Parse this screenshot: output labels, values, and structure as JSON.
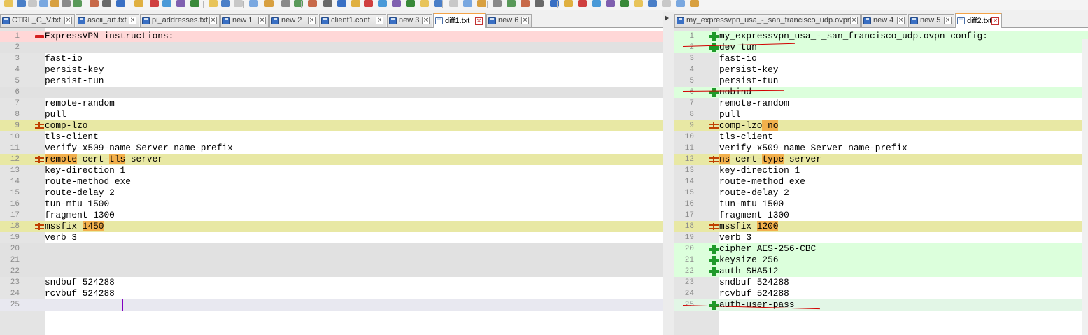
{
  "left_tabs": [
    {
      "label": "CTRL_C_V.txt",
      "active": false
    },
    {
      "label": "ascii_art.txt",
      "active": false
    },
    {
      "label": "pi_addresses.txt",
      "active": false
    },
    {
      "label": "new 1",
      "active": false
    },
    {
      "label": "new 2",
      "active": false
    },
    {
      "label": "client1.conf",
      "active": false
    },
    {
      "label": "new 3",
      "active": false
    },
    {
      "label": "diff1.txt",
      "active": true
    },
    {
      "label": "new 6",
      "active": false
    }
  ],
  "right_tabs": [
    {
      "label": "my_expressvpn_usa_-_san_francisco_udp.ovpn",
      "active": false
    },
    {
      "label": "new 4",
      "active": false
    },
    {
      "label": "new 5",
      "active": false
    },
    {
      "label": "diff2.txt",
      "active": true
    }
  ],
  "left_lines": [
    {
      "num": "1",
      "text": "ExpressVPN instructions:",
      "bg": "red",
      "marker": "minus"
    },
    {
      "num": "2",
      "text": "",
      "bg": "gray",
      "marker": ""
    },
    {
      "num": "3",
      "text": "fast-io",
      "bg": "",
      "marker": ""
    },
    {
      "num": "4",
      "text": "persist-key",
      "bg": "",
      "marker": ""
    },
    {
      "num": "5",
      "text": "persist-tun",
      "bg": "",
      "marker": ""
    },
    {
      "num": "6",
      "text": "",
      "bg": "gray",
      "marker": ""
    },
    {
      "num": "7",
      "text": "remote-random",
      "bg": "",
      "marker": ""
    },
    {
      "num": "8",
      "text": "pull",
      "bg": "",
      "marker": ""
    },
    {
      "num": "9",
      "text": "comp-lzo",
      "bg": "yellow",
      "marker": "change"
    },
    {
      "num": "10",
      "text": "tls-client",
      "bg": "",
      "marker": ""
    },
    {
      "num": "11",
      "text": "verify-x509-name Server name-prefix",
      "bg": "",
      "marker": ""
    },
    {
      "num": "12",
      "text": "",
      "bg": "yellow",
      "marker": "change",
      "parts": [
        {
          "t": "remote",
          "h": true
        },
        {
          "t": "-cert-",
          "h": false
        },
        {
          "t": "tls",
          "h": true
        },
        {
          "t": " server",
          "h": false
        }
      ]
    },
    {
      "num": "13",
      "text": "key-direction 1",
      "bg": "",
      "marker": ""
    },
    {
      "num": "14",
      "text": "route-method exe",
      "bg": "",
      "marker": ""
    },
    {
      "num": "15",
      "text": "route-delay 2",
      "bg": "",
      "marker": ""
    },
    {
      "num": "16",
      "text": "tun-mtu 1500",
      "bg": "",
      "marker": ""
    },
    {
      "num": "17",
      "text": "fragment 1300",
      "bg": "",
      "marker": ""
    },
    {
      "num": "18",
      "text": "",
      "bg": "yellow",
      "marker": "change",
      "parts": [
        {
          "t": "mssfix ",
          "h": false
        },
        {
          "t": "1450",
          "h": true
        }
      ]
    },
    {
      "num": "19",
      "text": "verb 3",
      "bg": "",
      "marker": ""
    },
    {
      "num": "20",
      "text": "",
      "bg": "gray",
      "marker": ""
    },
    {
      "num": "21",
      "text": "",
      "bg": "gray",
      "marker": ""
    },
    {
      "num": "22",
      "text": "",
      "bg": "gray",
      "marker": ""
    },
    {
      "num": "23",
      "text": "sndbuf 524288",
      "bg": "",
      "marker": ""
    },
    {
      "num": "24",
      "text": "rcvbuf 524288",
      "bg": "",
      "marker": ""
    },
    {
      "num": "25",
      "text": "",
      "bg": "caret",
      "marker": ""
    }
  ],
  "right_lines": [
    {
      "num": "1",
      "text": "my_expressvpn_usa_-_san_francisco_udp.ovpn config:",
      "bg": "green",
      "marker": "plus"
    },
    {
      "num": "2",
      "text": "dev tun",
      "bg": "green",
      "marker": "plus"
    },
    {
      "num": "3",
      "text": "fast-io",
      "bg": "",
      "marker": ""
    },
    {
      "num": "4",
      "text": "persist-key",
      "bg": "",
      "marker": ""
    },
    {
      "num": "5",
      "text": "persist-tun",
      "bg": "",
      "marker": ""
    },
    {
      "num": "6",
      "text": "nobind",
      "bg": "green",
      "marker": "plus"
    },
    {
      "num": "7",
      "text": "remote-random",
      "bg": "",
      "marker": ""
    },
    {
      "num": "8",
      "text": "pull",
      "bg": "",
      "marker": ""
    },
    {
      "num": "9",
      "text": "",
      "bg": "yellow",
      "marker": "change",
      "parts": [
        {
          "t": "comp-lzo",
          "h": false
        },
        {
          "t": " no",
          "h": true
        }
      ]
    },
    {
      "num": "10",
      "text": "tls-client",
      "bg": "",
      "marker": ""
    },
    {
      "num": "11",
      "text": "verify-x509-name Server name-prefix",
      "bg": "",
      "marker": ""
    },
    {
      "num": "12",
      "text": "",
      "bg": "yellow",
      "marker": "change",
      "parts": [
        {
          "t": "ns",
          "h": true
        },
        {
          "t": "-cert-",
          "h": false
        },
        {
          "t": "type",
          "h": true
        },
        {
          "t": " server",
          "h": false
        }
      ]
    },
    {
      "num": "13",
      "text": "key-direction 1",
      "bg": "",
      "marker": ""
    },
    {
      "num": "14",
      "text": "route-method exe",
      "bg": "",
      "marker": ""
    },
    {
      "num": "15",
      "text": "route-delay 2",
      "bg": "",
      "marker": ""
    },
    {
      "num": "16",
      "text": "tun-mtu 1500",
      "bg": "",
      "marker": ""
    },
    {
      "num": "17",
      "text": "fragment 1300",
      "bg": "",
      "marker": ""
    },
    {
      "num": "18",
      "text": "",
      "bg": "yellow",
      "marker": "change",
      "parts": [
        {
          "t": "mssfix ",
          "h": false
        },
        {
          "t": "1200",
          "h": true
        }
      ]
    },
    {
      "num": "19",
      "text": "verb 3",
      "bg": "",
      "marker": ""
    },
    {
      "num": "20",
      "text": "cipher AES-256-CBC",
      "bg": "green",
      "marker": "plus"
    },
    {
      "num": "21",
      "text": "keysize 256",
      "bg": "green",
      "marker": "plus"
    },
    {
      "num": "22",
      "text": "auth SHA512",
      "bg": "green",
      "marker": "plus"
    },
    {
      "num": "23",
      "text": "sndbuf 524288",
      "bg": "",
      "marker": ""
    },
    {
      "num": "24",
      "text": "rcvbuf 524288",
      "bg": "",
      "marker": ""
    },
    {
      "num": "25",
      "text": "auth-user-pass",
      "bg": "mint",
      "marker": "plus"
    }
  ],
  "colors": {
    "removed_bg": "#ffd7d7",
    "added_bg": "#dcffdc",
    "changed_bg": "#e8e8a4",
    "moved_gap_bg": "#e1e1e1",
    "inline_highlight": "#f2b04c",
    "annotation_strike": "#d20000"
  },
  "icons": {
    "minus_marker": "diff-removed-icon",
    "plus_marker": "diff-added-icon",
    "change_marker": "diff-changed-icon"
  }
}
